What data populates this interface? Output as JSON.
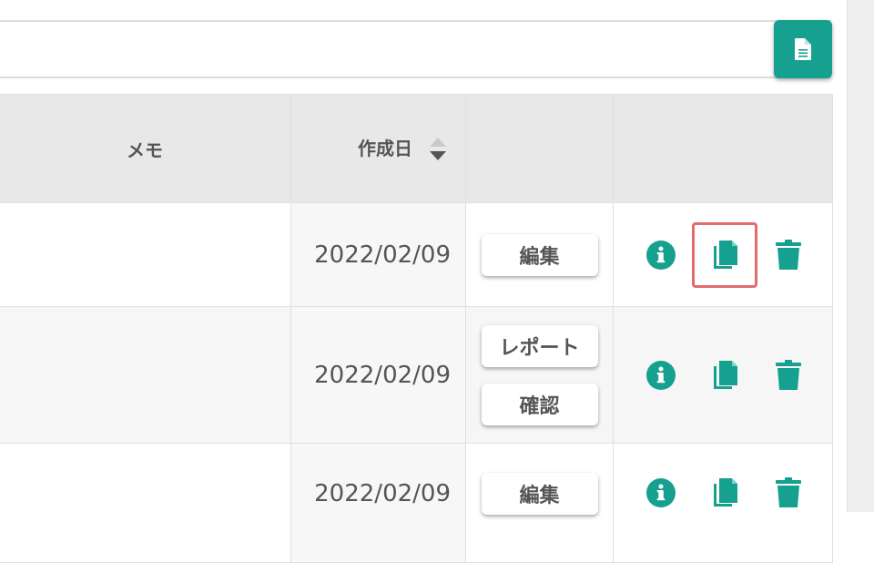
{
  "toolbar": {
    "document_button_icon": "document-icon"
  },
  "table": {
    "columns": [
      "メモ",
      "作成日",
      "",
      ""
    ],
    "sort_icon": "sort-icon",
    "rows": [
      {
        "memo": "",
        "created": "2022/02/09",
        "buttons": [
          "編集"
        ],
        "copy_focused": true
      },
      {
        "memo": "",
        "created": "2022/02/09",
        "buttons": [
          "レポート",
          "確認"
        ],
        "copy_focused": false
      },
      {
        "memo": "",
        "created": "2022/02/09",
        "buttons": [
          "編集"
        ],
        "copy_focused": false
      }
    ]
  },
  "colors": {
    "accent": "#16a08f",
    "focus_outline": "#e36b6b"
  }
}
